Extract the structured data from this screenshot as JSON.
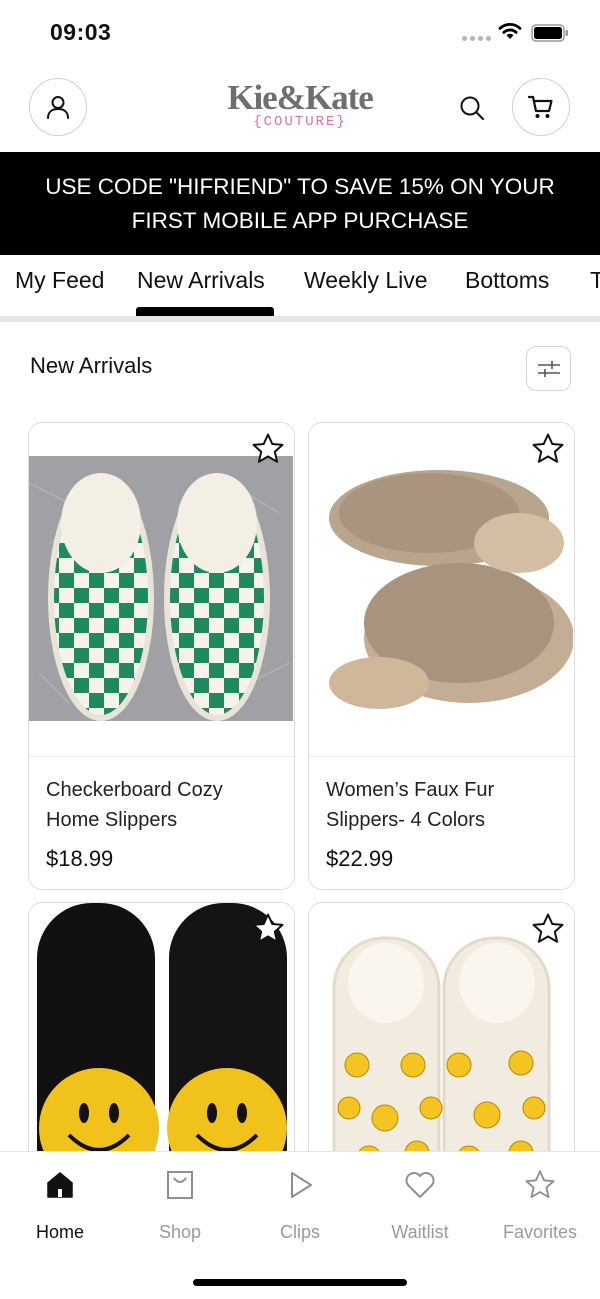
{
  "status_bar": {
    "time": "09:03"
  },
  "header": {
    "logo_main": "Kie&Kate",
    "logo_sub": "{COUTURE}",
    "colors": {
      "logo_gray": "#6f6f6f",
      "logo_pink": "#e070a8"
    }
  },
  "promo": {
    "text": "USE CODE \"HIFRIEND\" TO SAVE 15% ON YOUR FIRST MOBILE APP PURCHASE"
  },
  "tabs": [
    {
      "label": "My Feed",
      "active": false
    },
    {
      "label": "New Arrivals",
      "active": true
    },
    {
      "label": "Weekly Live",
      "active": false
    },
    {
      "label": "Bottoms",
      "active": false
    },
    {
      "label": "T",
      "active": false
    }
  ],
  "section": {
    "title": "New Arrivals"
  },
  "products": [
    {
      "title": "Checkerboard Cozy Home Slippers",
      "price": "$18.99",
      "image": "green-white-checkered-slippers"
    },
    {
      "title": "Women’s Faux Fur Slippers- 4 Colors",
      "price": "$22.99",
      "image": "tan-faux-fur-slippers"
    },
    {
      "title": "",
      "price": "",
      "image": "black-smiley-slippers"
    },
    {
      "title": "",
      "price": "",
      "image": "cream-smiley-slippers"
    }
  ],
  "bottom_nav": [
    {
      "label": "Home",
      "icon": "home-icon",
      "active": true
    },
    {
      "label": "Shop",
      "icon": "shopping-bag-icon",
      "active": false
    },
    {
      "label": "Clips",
      "icon": "play-icon",
      "active": false
    },
    {
      "label": "Waitlist",
      "icon": "heart-icon",
      "active": false
    },
    {
      "label": "Favorites",
      "icon": "star-icon",
      "active": false
    }
  ]
}
